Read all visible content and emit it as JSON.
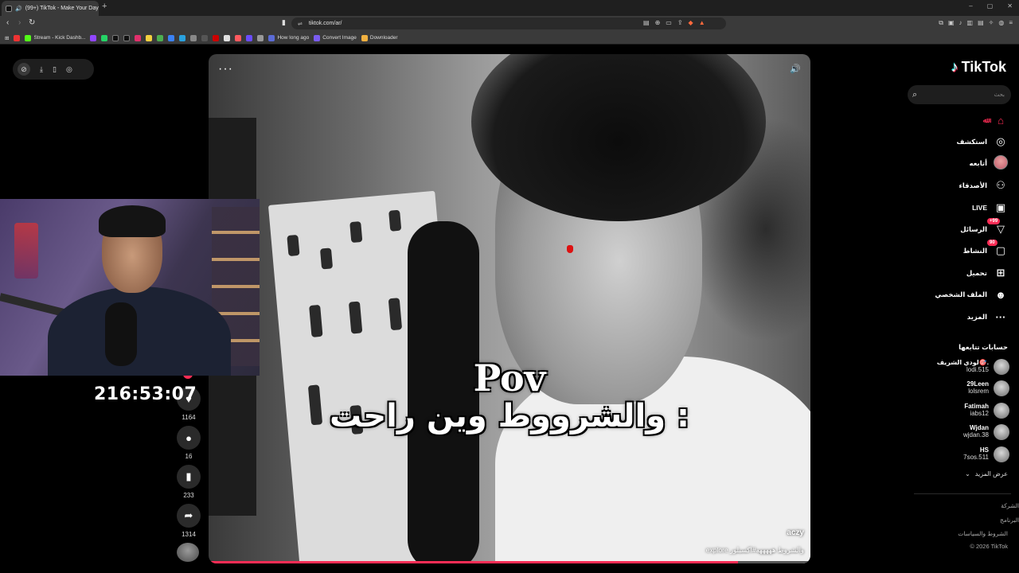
{
  "browser": {
    "tab_title": "(99+) TikTok - Make Your Day",
    "tab_close": "×",
    "new_tab": "+",
    "url": "tiktok.com/ar/",
    "window_controls": [
      "–",
      "▢",
      "✕"
    ]
  },
  "bookmarks": [
    {
      "label": "Stream - Kick Dashb...",
      "color": "#53fc18"
    },
    {
      "label": "How long ago",
      "color": "#5b6bd6"
    },
    {
      "label": "Convert Image",
      "color": "#7a5cf0"
    },
    {
      "label": "Downloader",
      "color": "#f0b040"
    }
  ],
  "video": {
    "menu": "···",
    "caption_top": "Pov",
    "caption_bottom": "والشرووط وين راحت :",
    "author": "aczy",
    "description": "والشروط هههههه#اكسبلور explore",
    "progress": 0.88
  },
  "actions": {
    "likes": "1164",
    "comments": "16",
    "saves": "233",
    "shares": "1314"
  },
  "timer": "216:53:07",
  "sidebar": {
    "logo": "TikTok",
    "search_placeholder": "بحث",
    "nav": [
      {
        "label": "ﷲ",
        "icon": "home-icon"
      },
      {
        "label": "استكشف",
        "icon": "compass-icon"
      },
      {
        "label": "أتابعه",
        "icon": "following-avatar"
      },
      {
        "label": "الأصدقاء",
        "icon": "friends-icon"
      },
      {
        "label": "LIVE",
        "icon": "live-icon"
      },
      {
        "label": "الرسائل",
        "icon": "messages-icon",
        "badge": "99+"
      },
      {
        "label": "النشاط",
        "icon": "activity-icon",
        "badge": "90"
      },
      {
        "label": "تحميل",
        "icon": "upload-icon"
      },
      {
        "label": "الملف الشخصي",
        "icon": "profile-icon"
      },
      {
        "label": "المزيد",
        "icon": "more-icon"
      }
    ],
    "following_title": "حسابات تتابعها",
    "accounts": [
      {
        "name": "لودي الشريف🎯.",
        "handle": "lodi.515"
      },
      {
        "name": "29Leen",
        "handle": "lolsrem"
      },
      {
        "name": "Fatimah",
        "handle": "iabs12"
      },
      {
        "name": "Wjdan",
        "handle": "wjdan.38"
      },
      {
        "name": "HS",
        "handle": "7sos.511"
      }
    ],
    "show_more": "عرض المزيد",
    "footer": [
      "الشركة",
      "البرنامج",
      "الشروط والسياسات",
      "© 2026 TikTok"
    ]
  }
}
